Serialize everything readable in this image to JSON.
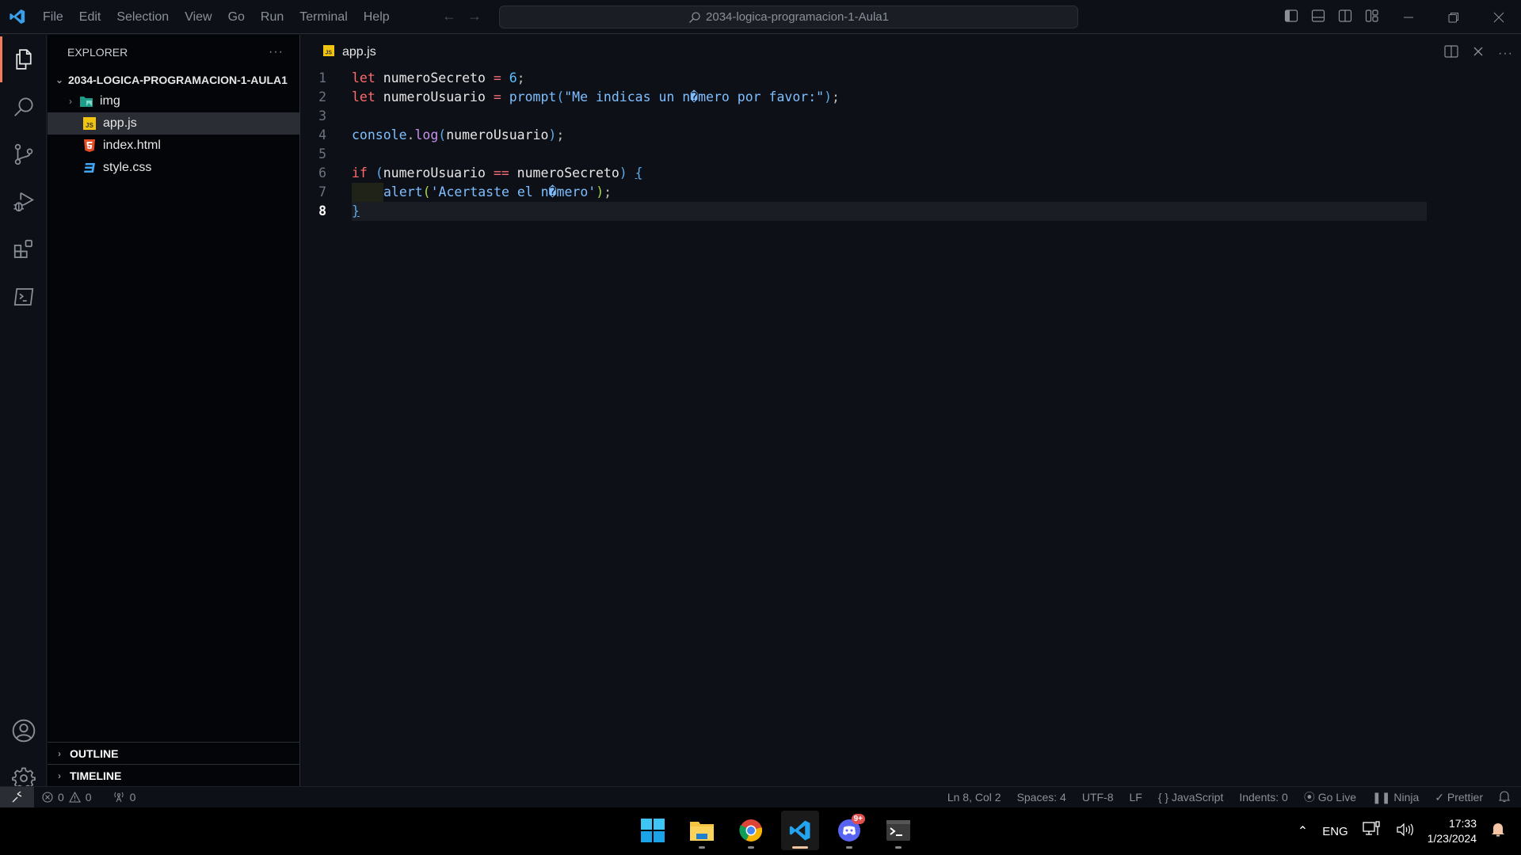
{
  "titlebar": {
    "menu": [
      "File",
      "Edit",
      "Selection",
      "View",
      "Go",
      "Run",
      "Terminal",
      "Help"
    ],
    "search_text": "2034-logica-programacion-1-Aula1"
  },
  "activitybar": {
    "items": [
      "explorer-icon",
      "search-icon",
      "source-control-icon",
      "run-debug-icon",
      "extensions-icon",
      "remote-terminal-icon"
    ],
    "bottom": [
      "account-icon",
      "settings-gear-icon"
    ],
    "accent": "#f07d5c"
  },
  "sidebar": {
    "title": "EXPLORER",
    "more": "···",
    "folder": "2034-LOGICA-PROGRAMACION-1-AULA1",
    "files": [
      {
        "name": "img",
        "type": "folder"
      },
      {
        "name": "app.js",
        "type": "js",
        "selected": true
      },
      {
        "name": "index.html",
        "type": "html"
      },
      {
        "name": "style.css",
        "type": "css"
      }
    ],
    "sections": [
      "OUTLINE",
      "TIMELINE"
    ]
  },
  "editor": {
    "tab": "app.js",
    "lines": [
      "let numeroSecreto = 6;",
      "let numeroUsuario = prompt(\"Me indicas un n�mero por favor:\");",
      "",
      "console.log(numeroUsuario);",
      "",
      "if (numeroUsuario == numeroSecreto) {",
      "    alert('Acertaste el n�mero');",
      "}"
    ],
    "current_line": 8
  },
  "statusbar": {
    "errors": "0",
    "warnings": "0",
    "ports": "0",
    "position": "Ln 8, Col 2",
    "spaces": "Spaces: 4",
    "encoding": "UTF-8",
    "eol": "LF",
    "language": "JavaScript",
    "indents": "Indents: 0",
    "golive": "Go Live",
    "ninja": "Ninja",
    "prettier": "Prettier"
  },
  "taskbar": {
    "apps": [
      "windows-start",
      "file-explorer",
      "chrome",
      "vscode",
      "discord",
      "terminal"
    ],
    "discord_badge": "9+",
    "lang": "ENG",
    "time": "17:33",
    "date": "1/23/2024"
  }
}
